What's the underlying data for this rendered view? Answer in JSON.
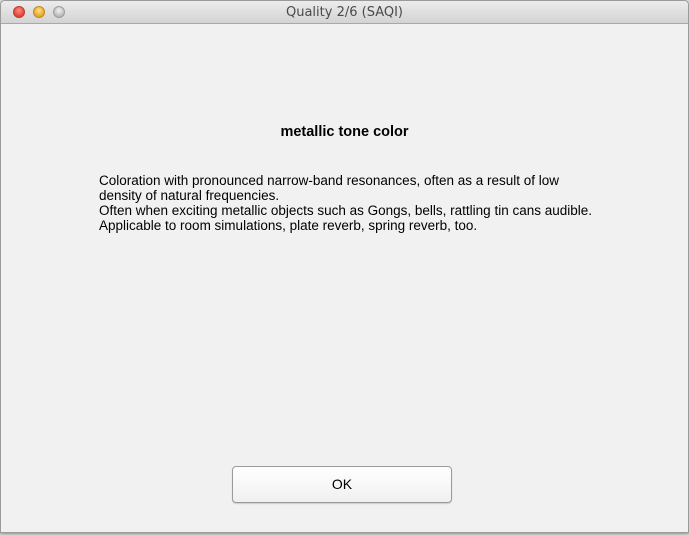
{
  "window": {
    "title": "Quality 2/6 (SAQI)"
  },
  "main": {
    "heading": "metallic tone color",
    "description_lines": [
      "Coloration with pronounced narrow-band resonances, often as a result of low density of natural frequencies.",
      "Often when exciting metallic objects such as Gongs, bells, rattling tin cans audible.",
      "Applicable to room simulations, plate reverb, spring reverb, too."
    ]
  },
  "buttons": {
    "ok_label": "OK"
  },
  "colors": {
    "close": "#e0443a",
    "minimize": "#e2a728",
    "zoom": "#b9b9b9"
  }
}
